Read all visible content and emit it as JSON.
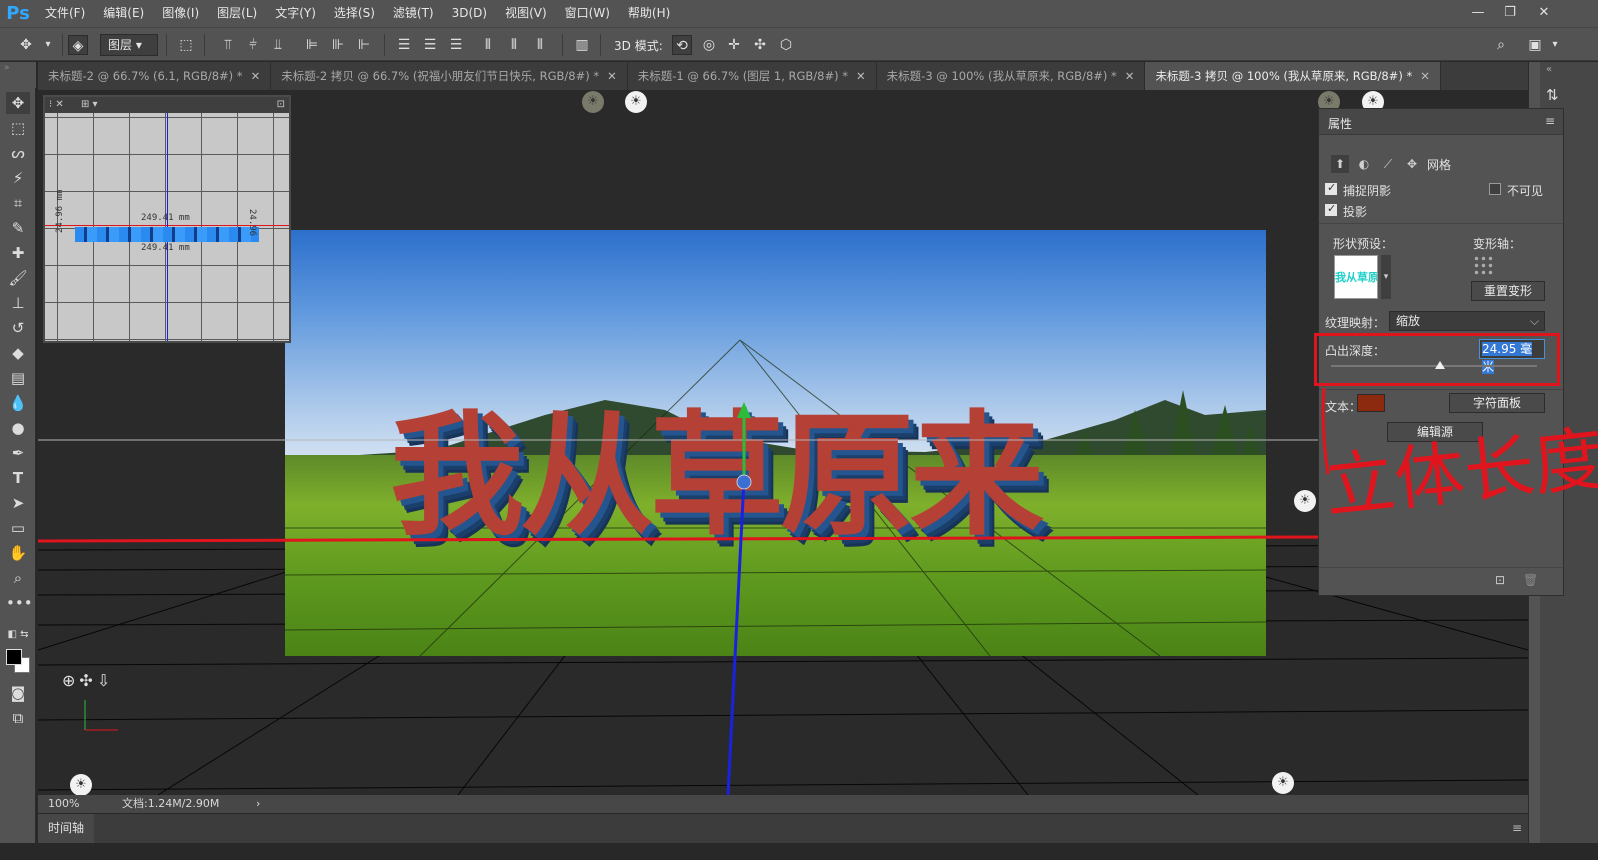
{
  "menubar": {
    "logo": "Ps",
    "items": [
      "文件(F)",
      "编辑(E)",
      "图像(I)",
      "图层(L)",
      "文字(Y)",
      "选择(S)",
      "滤镜(T)",
      "3D(D)",
      "视图(V)",
      "窗口(W)",
      "帮助(H)"
    ]
  },
  "options": {
    "layer_select": "图层",
    "mode3d_label": "3D 模式:"
  },
  "tabs": [
    {
      "label": "未标题-2 @ 66.7% (6.1, RGB/8#) *",
      "active": false
    },
    {
      "label": "未标题-2 拷贝 @ 66.7% (祝福小朋友们节日快乐, RGB/8#) *",
      "active": false
    },
    {
      "label": "未标题-1 @ 66.7% (图层 1, RGB/8#) *",
      "active": false
    },
    {
      "label": "未标题-3 @ 100% (我从草原来, RGB/8#) *",
      "active": false
    },
    {
      "label": "未标题-3 拷贝 @ 100% (我从草原来, RGB/8#) *",
      "active": true
    }
  ],
  "canvas": {
    "title_text": "我从草原来"
  },
  "navigator": {
    "meas_top": "249.41 mm",
    "meas_bottom": "249.41 mm",
    "meas_left": "24.96 mm",
    "meas_right": "24.96"
  },
  "properties": {
    "title": "属性",
    "grid_label": "网格",
    "catch_shadow": "捕捉阴影",
    "cast_shadow": "投影",
    "invisible": "不可见",
    "shape_preset_label": "形状预设：",
    "shape_preview_text": "我从草原来",
    "deform_axis_label": "变形轴：",
    "reset_deform": "重置变形",
    "texture_map_label": "纹理映射：",
    "texture_map_value": "缩放",
    "extrude_label": "凸出深度：",
    "extrude_value": "24.95 毫米",
    "extrude_slider_level": 0.53,
    "text_label": "文本：",
    "text_color": "#8b2a0e",
    "char_panel": "字符面板",
    "edit_source": "编辑源"
  },
  "annotation": {
    "text": "立体长度",
    "color": "#e0141c"
  },
  "status": {
    "zoom": "100%",
    "doc": "文档:1.24M/2.90M"
  },
  "timeline": {
    "tab": "时间轴"
  }
}
